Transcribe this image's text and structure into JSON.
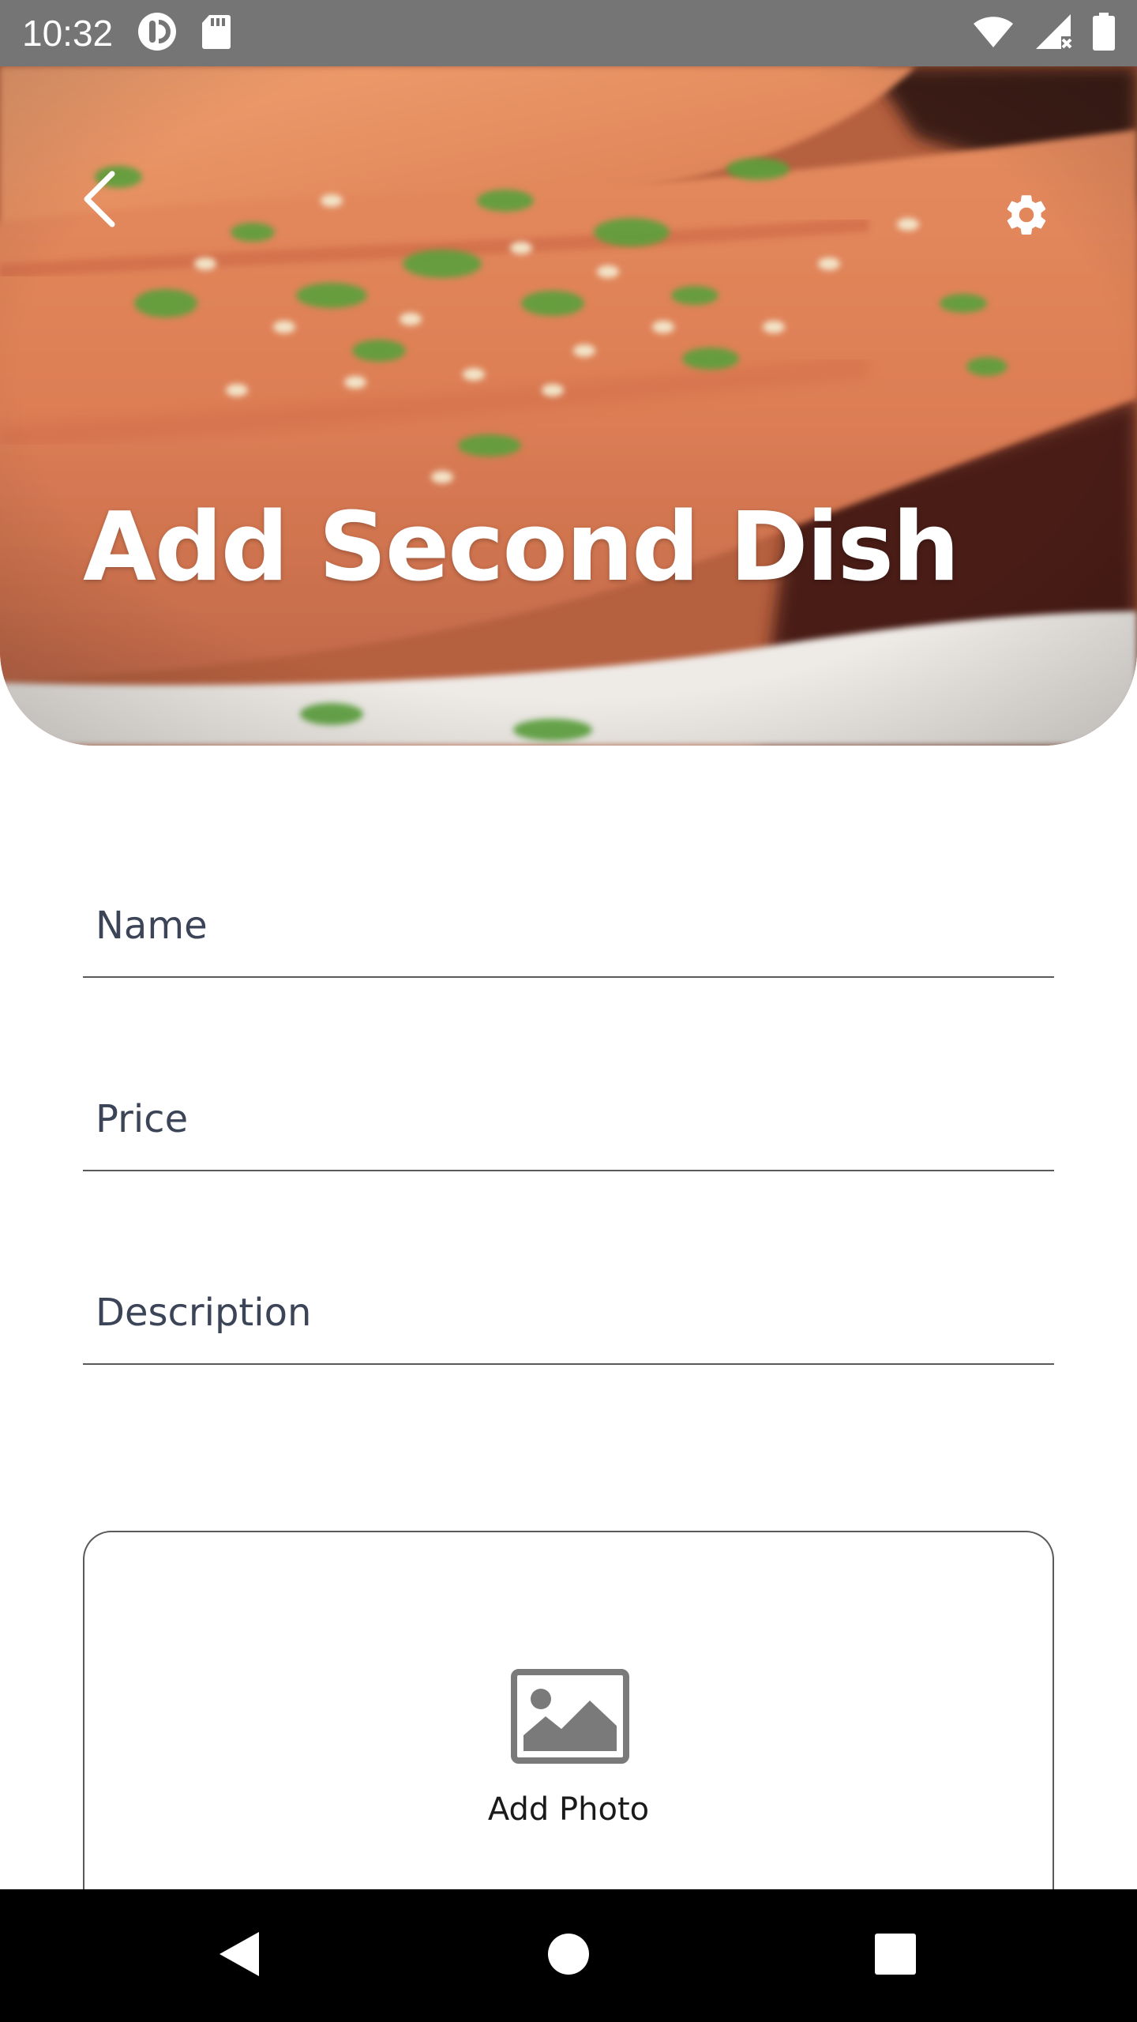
{
  "status_bar": {
    "time": "10:32",
    "left_icons": [
      "pocket-casts-icon",
      "sd-card-icon"
    ],
    "right_icons": [
      "wifi-icon",
      "cellular-signal-icon",
      "battery-icon"
    ]
  },
  "header": {
    "title": "Add Second Dish",
    "back_icon": "chevron-left-icon",
    "settings_icon": "gear-icon"
  },
  "form": {
    "name_placeholder": "Name",
    "price_placeholder": "Price",
    "description_placeholder": "Description"
  },
  "photo": {
    "icon": "image-icon",
    "label": "Add Photo"
  },
  "nav_bar": {
    "buttons": [
      "back-triangle-icon",
      "home-circle-icon",
      "recents-square-icon"
    ]
  },
  "colors": {
    "status_bar": "#757575",
    "nav_bar": "#000000",
    "field_text": "#3c4457",
    "field_underline": "#5a5a5a",
    "title_text": "#ffffff"
  }
}
